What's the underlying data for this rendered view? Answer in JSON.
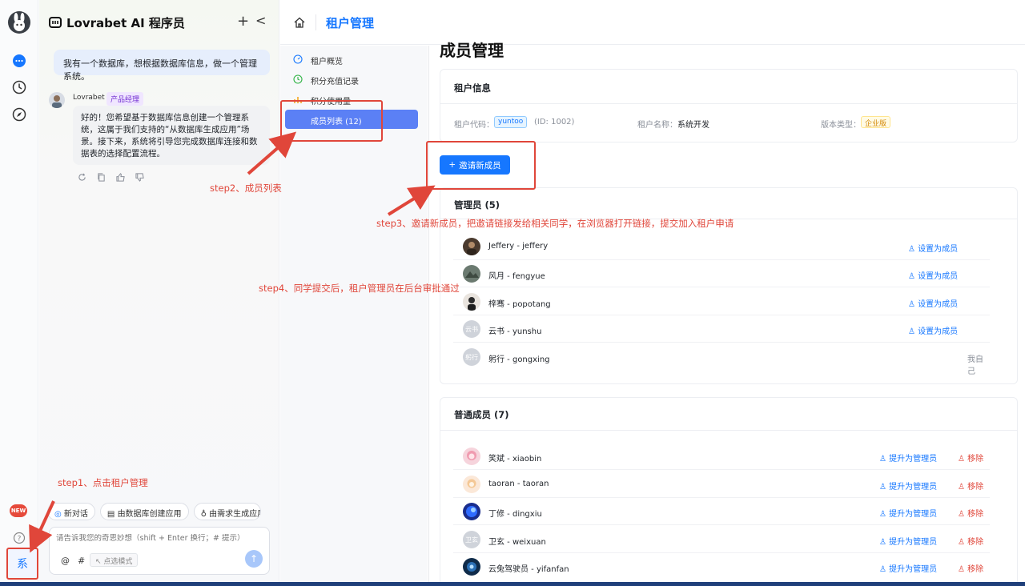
{
  "chat": {
    "title": "Lovrabet AI 程序员",
    "plus": "+",
    "collapse": "<",
    "user_message": "我有一个数据库，想根据数据库信息，做一个管理系统。",
    "bot_name": "Lovrabet",
    "bot_role": "产品经理",
    "bot_message": "好的！您希望基于数据库信息创建一个管理系统，这属于我们支持的“从数据库生成应用”场景。接下来，系统将引导您完成数据库连接和数据表的选择配置流程。",
    "quick_actions": [
      "新对话",
      "由数据库创建应用",
      "由需求生成应用"
    ],
    "input_placeholder": "请告诉我您的奇思妙想（shift + Enter 换行；# 提示）",
    "at_label": "@",
    "hash_label": "#",
    "mode_label": "点选模式"
  },
  "rail": {
    "new_badge": "NEW",
    "system_button": "系"
  },
  "header": {
    "title": "租户管理"
  },
  "subnav": {
    "items": [
      {
        "label": "租户概览"
      },
      {
        "label": "积分充值记录"
      },
      {
        "label": "积分使用量"
      },
      {
        "label": "成员列表 (12)"
      }
    ]
  },
  "main": {
    "heading": "成员管理",
    "tenant_info": {
      "title": "租户信息",
      "code_label": "租户代码：",
      "code_value": "yuntoo",
      "id_text": "(ID: 1002)",
      "name_label": "租户名称：",
      "name_value": "系统开发",
      "version_label": "版本类型：",
      "version_value": "企业版"
    },
    "invite_button": "邀请新成员",
    "admins": {
      "title": "管理员 (5)",
      "rows": [
        {
          "name": "Jeffery - jeffery",
          "action": "设置为成员"
        },
        {
          "name": "风月 - fengyue",
          "action": "设置为成员"
        },
        {
          "name": "梓骞 - popotang",
          "action": "设置为成员"
        },
        {
          "name": "云书 - yunshu",
          "avatar_text": "云书",
          "action": "设置为成员"
        },
        {
          "name": "躬行 - gongxing",
          "avatar_text": "躬行",
          "self_label": "我自己"
        }
      ]
    },
    "members": {
      "title": "普通成员 (7)",
      "promote_label": "提升为管理员",
      "remove_label": "移除",
      "rows": [
        {
          "name": "笑斌 - xiaobin"
        },
        {
          "name": "taoran - taoran"
        },
        {
          "name": "丁修 - dingxiu"
        },
        {
          "name": "卫玄 - weixuan",
          "avatar_text": "卫玄"
        },
        {
          "name": "云兔驾驶员 - yifanfan"
        }
      ]
    }
  },
  "annotations": {
    "step1": "step1、点击租户管理",
    "step2": "step2、成员列表",
    "step3": "step3、邀请新成员，把邀请链接发给相关同学，在浏览器打开链接，提交加入租户申请",
    "step4": "step4、同学提交后，租户管理员在后台审批通过"
  },
  "colors": {
    "accent": "#1677ff",
    "annotation_red": "#e0463a",
    "active_nav": "#5b80f5"
  }
}
